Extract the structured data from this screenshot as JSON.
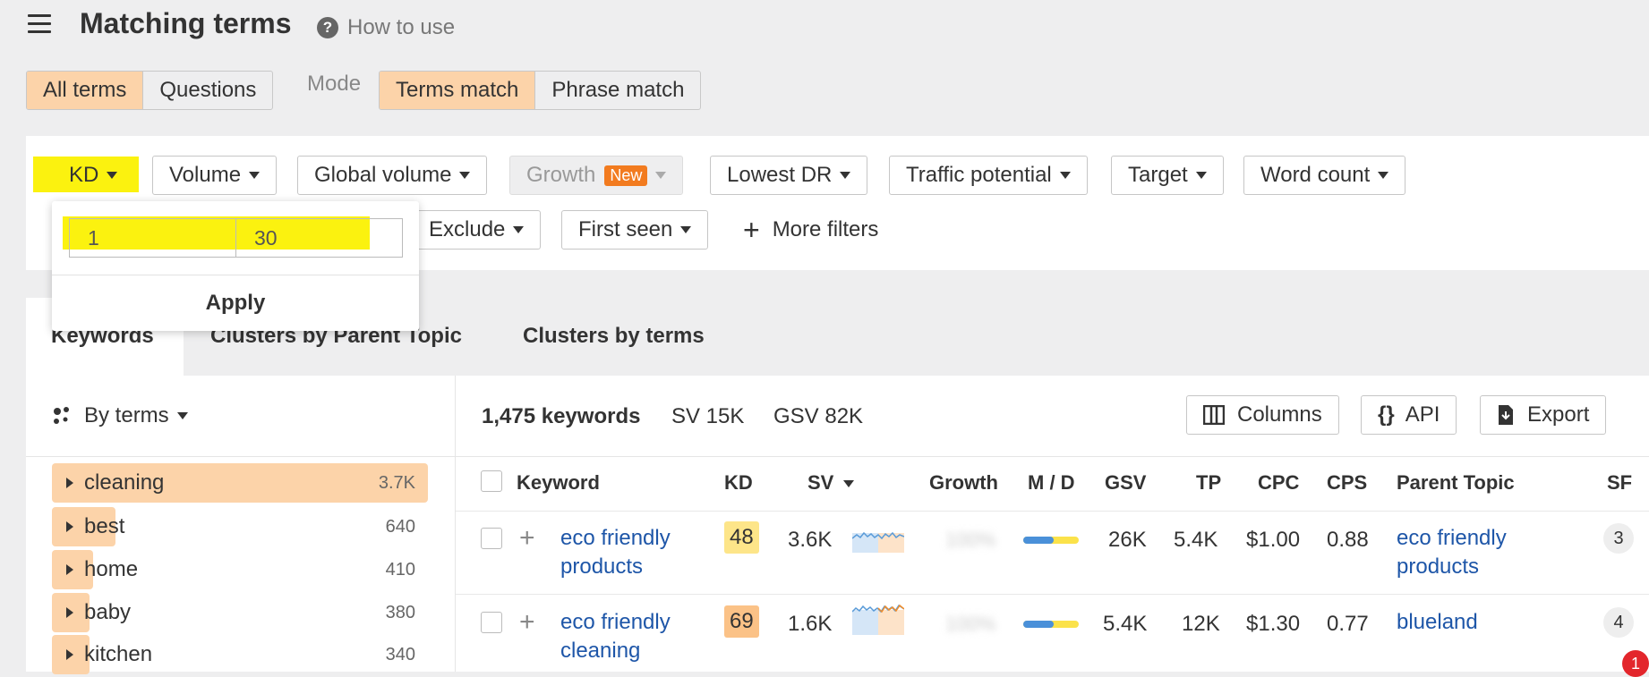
{
  "header": {
    "title": "Matching terms",
    "help_label": "How to use"
  },
  "term_tabs": {
    "all_terms": "All terms",
    "questions": "Questions"
  },
  "mode": {
    "label": "Mode",
    "terms_match": "Terms match",
    "phrase_match": "Phrase match"
  },
  "filters": {
    "kd": "KD",
    "volume": "Volume",
    "global_volume": "Global volume",
    "growth": "Growth",
    "growth_badge": "New",
    "lowest_dr": "Lowest DR",
    "traffic_potential": "Traffic potential",
    "target": "Target",
    "word_count": "Word count",
    "exclude": "Exclude",
    "first_seen": "First seen",
    "more_filters": "More filters"
  },
  "kd_popup": {
    "min_value": "1",
    "max_value": "30",
    "apply_label": "Apply"
  },
  "view_tabs": {
    "keywords": "Keywords",
    "clusters_parent": "Clusters by Parent Topic",
    "clusters_terms": "Clusters by terms"
  },
  "left": {
    "group_by": "By terms",
    "terms": [
      {
        "label": "cleaning",
        "count": "3.7K",
        "fill": 1.0
      },
      {
        "label": "best",
        "count": "640",
        "fill": 0.17
      },
      {
        "label": "home",
        "count": "410",
        "fill": 0.11
      },
      {
        "label": "baby",
        "count": "380",
        "fill": 0.1
      },
      {
        "label": "kitchen",
        "count": "340",
        "fill": 0.09
      }
    ]
  },
  "summary": {
    "keywords": "1,475 keywords",
    "sv": "SV 15K",
    "gsv": "GSV 82K"
  },
  "toolbar": {
    "columns": "Columns",
    "api": "API",
    "export": "Export"
  },
  "table": {
    "headers": {
      "keyword": "Keyword",
      "kd": "KD",
      "sv": "SV",
      "growth": "Growth",
      "md": "M / D",
      "gsv": "GSV",
      "tp": "TP",
      "cpc": "CPC",
      "cps": "CPS",
      "parent_topic": "Parent Topic",
      "sf": "SF"
    },
    "rows": [
      {
        "keyword_line1": "eco friendly",
        "keyword_line2": "products",
        "kd": "48",
        "kd_color": "#fde589",
        "sv": "3.6K",
        "growth": "100%",
        "gsv": "26K",
        "tp": "5.4K",
        "cpc": "$1.00",
        "cps": "0.88",
        "parent_line1": "eco friendly",
        "parent_line2": "products",
        "sf": "3"
      },
      {
        "keyword_line1": "eco friendly",
        "keyword_line2": "cleaning",
        "kd": "69",
        "kd_color": "#fbc287",
        "sv": "1.6K",
        "growth": "100%",
        "gsv": "5.4K",
        "tp": "12K",
        "cpc": "$1.30",
        "cps": "0.77",
        "parent_line1": "blueland",
        "parent_line2": "",
        "sf": "4"
      }
    ]
  },
  "notification_count": "1",
  "icons": [
    "menu-icon",
    "help-icon",
    "caret-down-icon",
    "plus-icon",
    "cluster-icon",
    "columns-icon",
    "api-icon",
    "export-icon",
    "triangle-right-icon"
  ]
}
